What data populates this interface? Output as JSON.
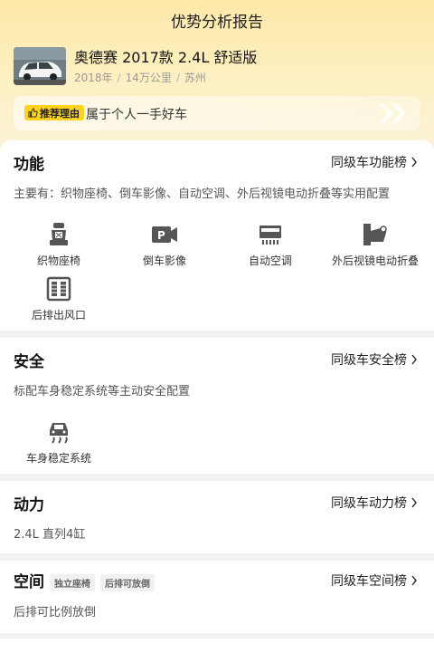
{
  "header": {
    "title": "优势分析报告"
  },
  "car": {
    "name": "奥德赛 2017款 2.4L 舒适版",
    "year": "2018年",
    "mileage": "14万公里",
    "city": "苏州"
  },
  "reason": {
    "badge": "推荐理由",
    "text": "属于个人一手好车"
  },
  "sections": {
    "function": {
      "title": "功能",
      "link": "同级车功能榜",
      "desc": "主要有：织物座椅、倒车影像、自动空调、外后视镜电动折叠等实用配置",
      "features": [
        {
          "label": "织物座椅",
          "icon": "seat-icon"
        },
        {
          "label": "倒车影像",
          "icon": "reverse-camera-icon"
        },
        {
          "label": "自动空调",
          "icon": "air-conditioner-icon"
        },
        {
          "label": "外后视镜电动折叠",
          "icon": "mirror-fold-icon"
        },
        {
          "label": "后排出风口",
          "icon": "rear-vent-icon"
        }
      ]
    },
    "safety": {
      "title": "安全",
      "link": "同级车安全榜",
      "desc": "标配车身稳定系统等主动安全配置",
      "features": [
        {
          "label": "车身稳定系统",
          "icon": "stability-control-icon"
        }
      ]
    },
    "power": {
      "title": "动力",
      "link": "同级车动力榜",
      "desc": "2.4L 直列4缸"
    },
    "space": {
      "title": "空间",
      "tags": [
        "独立座椅",
        "后排可放倒"
      ],
      "link": "同级车空间榜",
      "desc": "后排可比例放倒"
    }
  },
  "colors": {
    "accent": "#ffd21f",
    "hero_top": "#fde9a8",
    "bg": "#f2f2f2"
  }
}
